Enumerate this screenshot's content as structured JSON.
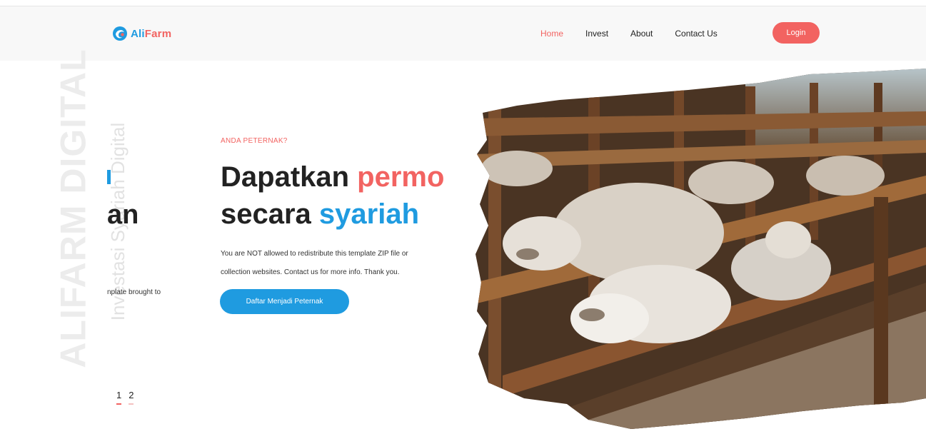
{
  "brand": {
    "part1": "Ali",
    "part2": "Farm",
    "icon": "logo-swirl-icon"
  },
  "nav": {
    "items": [
      {
        "label": "Home",
        "active": true
      },
      {
        "label": "Invest",
        "active": false
      },
      {
        "label": "About",
        "active": false
      },
      {
        "label": "Contact Us",
        "active": false
      }
    ],
    "login_label": "Login"
  },
  "watermark": {
    "primary": "ALIFARM DIGITAL",
    "secondary": "Investasi Syariah Digital"
  },
  "prev_slide": {
    "word": "an",
    "text": "nplate brought to"
  },
  "hero": {
    "eyebrow": "ANDA PETERNAK?",
    "title_part1": "Dapatkan ",
    "title_highlight1": "permo",
    "title_part2": "secara ",
    "title_highlight2": "syariah",
    "desc_line1": "You are NOT allowed to redistribute this template ZIP file or",
    "desc_line2": "collection websites. Contact us for more info. Thank you.",
    "cta_label": "Daftar Menjadi Peternak"
  },
  "pagination": [
    "1",
    "2"
  ],
  "colors": {
    "accent_red": "#f26361",
    "accent_blue": "#1f9be0",
    "nav_bg": "#f8f8f8"
  },
  "image": {
    "subject": "sheep-feeding-pen-photo"
  }
}
